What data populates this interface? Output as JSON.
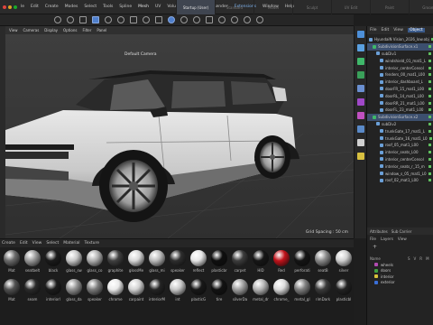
{
  "menubar": {
    "items": [
      "le",
      "Edit",
      "Create",
      "Modes",
      "Select",
      "Tools",
      "Spline",
      "Mesh",
      "UV",
      "Volume",
      "MoGraph",
      "Render",
      "Extensions",
      "Window",
      "Help"
    ],
    "layouts": [
      "Startup (User)",
      "Standard",
      "Model",
      "Sculpt",
      "UV Edit",
      "Paint",
      "Groom",
      "Track",
      "Script"
    ]
  },
  "viewport": {
    "menu": [
      "View",
      "Cameras",
      "Display",
      "Options",
      "Filter",
      "Panel"
    ],
    "camera_label": "Default Camera",
    "grid_spacing": "Grid Spacing : 50 cm"
  },
  "material_manager": {
    "tabs": [
      "Create",
      "Edit",
      "View",
      "Select",
      "Material",
      "Texture"
    ],
    "materials": [
      {
        "label": "Mat",
        "color": "#6a6a6a"
      },
      {
        "label": "seatbelt",
        "color": "#9a9a9a"
      },
      {
        "label": "black",
        "color": "#1a1a1a"
      },
      {
        "label": "glass_sw",
        "color": "#c8c8c8"
      },
      {
        "label": "glass_co",
        "color": "#b0b0b0"
      },
      {
        "label": "graphite",
        "color": "#404040"
      },
      {
        "label": "glossMe",
        "color": "#d8d8d8"
      },
      {
        "label": "glass_mi",
        "color": "#bcbcbc"
      },
      {
        "label": "speaker",
        "color": "#2e2e2e"
      },
      {
        "label": "reflect",
        "color": "#e6e6e6"
      },
      {
        "label": "plasticbr",
        "color": "#0f0f0f"
      },
      {
        "label": "carpet",
        "color": "#3c3c3c"
      },
      {
        "label": "HID",
        "color": "#161616"
      },
      {
        "label": "Red",
        "color": "#c1121a"
      },
      {
        "label": "perforati",
        "color": "#141414"
      },
      {
        "label": "seatB",
        "color": "#8a8a8a"
      },
      {
        "label": "silver",
        "color": "#d0d0d0"
      },
      {
        "label": "Mat",
        "color": "#505050"
      },
      {
        "label": "seam",
        "color": "#2a2a2a"
      },
      {
        "label": "interiorl",
        "color": "#1c1c1c"
      },
      {
        "label": "glass_da",
        "color": "#909090"
      },
      {
        "label": "speaker",
        "color": "#7a7a7a"
      },
      {
        "label": "chrome",
        "color": "#eaeaea"
      },
      {
        "label": "carpaint",
        "color": "#d2d2d2"
      },
      {
        "label": "interiorM",
        "color": "#242424"
      },
      {
        "label": "int",
        "color": "#c9c9c9"
      },
      {
        "label": "plasticG",
        "color": "#181818"
      },
      {
        "label": "tire",
        "color": "#121212"
      },
      {
        "label": "silverDa",
        "color": "#a0a0a0"
      },
      {
        "label": "metal_dr",
        "color": "#b5b5b5"
      },
      {
        "label": "chrome_",
        "color": "#dcdcdc"
      },
      {
        "label": "metal_gl",
        "color": "#7e7e7e"
      },
      {
        "label": "rimDark",
        "color": "#3a3a3a"
      },
      {
        "label": "plasticbl",
        "color": "#222222"
      }
    ]
  },
  "object_manager": {
    "tabs": [
      "File",
      "Edit",
      "View",
      "Object"
    ],
    "rows": [
      {
        "label": "HyundaiN Vision_2026_low.obj",
        "indent": 0,
        "sel": false
      },
      {
        "label": "SubdivisionSurface.x1",
        "indent": 1,
        "sel": true
      },
      {
        "label": "subDiv1",
        "indent": 2,
        "sel": false
      },
      {
        "label": "windshield_01_mat1_L",
        "indent": 3,
        "sel": false
      },
      {
        "label": "interior_centerConsol",
        "indent": 3,
        "sel": false
      },
      {
        "label": "fenders_00_mat1_L00",
        "indent": 3,
        "sel": false
      },
      {
        "label": "interior_dashboard_L",
        "indent": 3,
        "sel": false
      },
      {
        "label": "doorFR_15_mat1_L00",
        "indent": 3,
        "sel": false
      },
      {
        "label": "doorRL_14_mat1_L00",
        "indent": 3,
        "sel": false
      },
      {
        "label": "doorRR_21_mat1_L00",
        "indent": 3,
        "sel": false
      },
      {
        "label": "doorFL_23_mat1_L00",
        "indent": 3,
        "sel": false
      },
      {
        "label": "SubdivisionSurface.x2",
        "indent": 1,
        "sel": true
      },
      {
        "label": "subDiv2",
        "indent": 2,
        "sel": false
      },
      {
        "label": "trunkGate_17_mat1_L",
        "indent": 3,
        "sel": false
      },
      {
        "label": "trunkGate_16_mat1_L0",
        "indent": 3,
        "sel": false
      },
      {
        "label": "roof_05_mat1_L00",
        "indent": 3,
        "sel": false
      },
      {
        "label": "interior_seats_L00",
        "indent": 3,
        "sel": false
      },
      {
        "label": "interior_centerConsol",
        "indent": 3,
        "sel": false
      },
      {
        "label": "interior_seats_r_15_m",
        "indent": 3,
        "sel": false
      },
      {
        "label": "window_s_05_mat1_L0",
        "indent": 3,
        "sel": false
      },
      {
        "label": "roof_02_mat1_L00",
        "indent": 3,
        "sel": false
      }
    ]
  },
  "layer_manager": {
    "tabs": [
      "Attributes",
      "Sub Carrier"
    ],
    "menu": [
      "File",
      "Layers",
      "View"
    ],
    "header": [
      "Name",
      "S",
      "V",
      "R",
      "M"
    ],
    "rows": [
      {
        "label": "wheels",
        "color": "#b04bb0"
      },
      {
        "label": "doors",
        "color": "#3fa03f"
      },
      {
        "label": "interior",
        "color": "#d8c23a"
      },
      {
        "label": "exterior",
        "color": "#3a6fd8"
      }
    ]
  }
}
